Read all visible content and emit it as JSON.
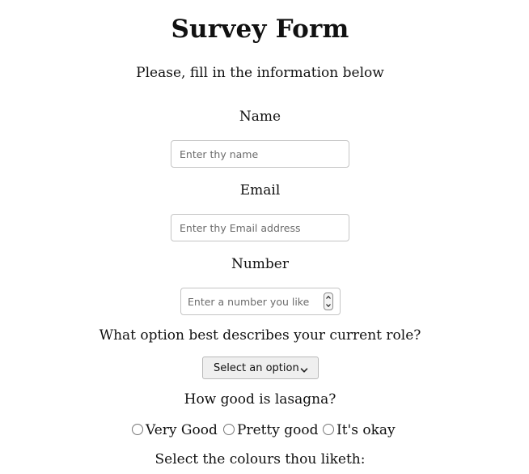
{
  "form": {
    "title": "Survey Form",
    "description": "Please, fill in the information below",
    "name": {
      "label": "Name",
      "placeholder": "Enter thy name"
    },
    "email": {
      "label": "Email",
      "placeholder": "Enter thy Email address"
    },
    "number": {
      "label": "Number",
      "placeholder": "Enter a number you like"
    },
    "role": {
      "label": "What option best describes your current role?",
      "selected": "Select an option"
    },
    "lasagna": {
      "label": "How good is lasagna?",
      "options": [
        "Very Good",
        "Pretty good",
        "It's okay"
      ]
    },
    "colours": {
      "label": "Select the colours thou liketh:"
    }
  },
  "icons": {
    "select_chevron": "chevron-down-icon",
    "spinner_up": "chevron-up-icon",
    "spinner_down": "chevron-down-icon"
  }
}
